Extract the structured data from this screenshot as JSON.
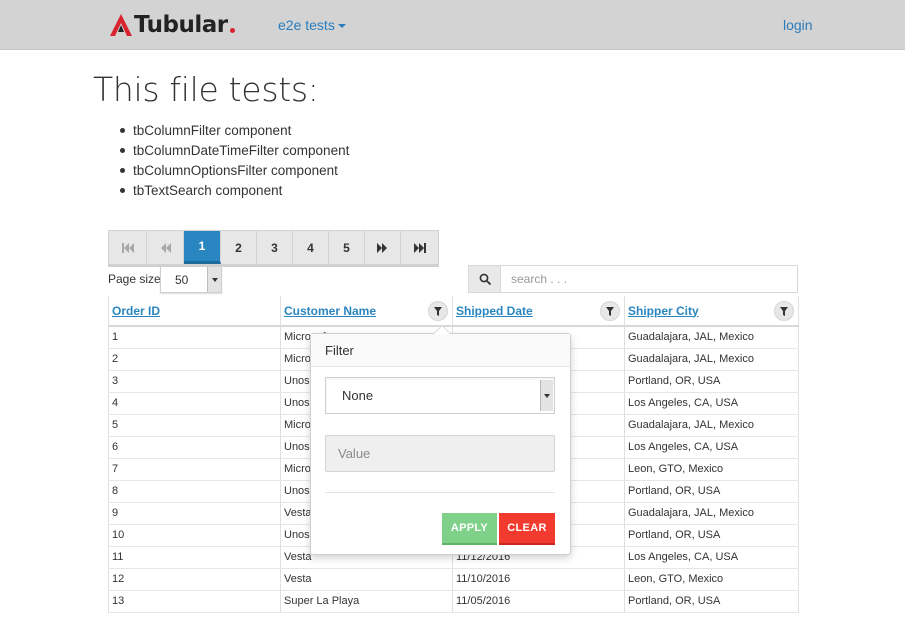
{
  "navbar": {
    "brand": "Tubular",
    "dropdown_label": "e2e tests",
    "login_label": "login"
  },
  "intro": {
    "headline": "This file tests:",
    "items": [
      "tbColumnFilter component",
      "tbColumnDateTimeFilter component",
      "tbColumnOptionsFilter component",
      "tbTextSearch component"
    ]
  },
  "pager": {
    "pages": [
      "1",
      "2",
      "3",
      "4",
      "5"
    ],
    "active_page": "1",
    "icons": [
      "first-page-icon",
      "previous-page-icon",
      "next-page-icon",
      "last-page-icon"
    ]
  },
  "page_size": {
    "label": "Page size:",
    "value": "50"
  },
  "search": {
    "placeholder": "search . . .",
    "icon": "search-icon"
  },
  "table": {
    "columns": [
      "Order ID",
      "Customer Name",
      "Shipped Date",
      "Shipper City"
    ],
    "rows": [
      [
        "1",
        "Microsoft",
        "",
        "Guadalajara, JAL, Mexico"
      ],
      [
        "2",
        "Microsoft",
        "",
        "Guadalajara, JAL, Mexico"
      ],
      [
        "3",
        "Unosquare LLC",
        "",
        "Portland, OR, USA"
      ],
      [
        "4",
        "Unosquare LLC",
        "",
        "Los Angeles, CA, USA"
      ],
      [
        "5",
        "Microsoft",
        "",
        "Guadalajara, JAL, Mexico"
      ],
      [
        "6",
        "Unosquare LLC",
        "",
        "Los Angeles, CA, USA"
      ],
      [
        "7",
        "Microsoft",
        "",
        "Leon, GTO, Mexico"
      ],
      [
        "8",
        "Unosquare LLC",
        "",
        "Portland, OR, USA"
      ],
      [
        "9",
        "Vesta",
        "",
        "Guadalajara, JAL, Mexico"
      ],
      [
        "10",
        "Unosquare LLC",
        "",
        "Portland, OR, USA"
      ],
      [
        "11",
        "Vesta",
        "11/12/2016",
        "Los Angeles, CA, USA"
      ],
      [
        "12",
        "Vesta",
        "11/10/2016",
        "Leon, GTO, Mexico"
      ],
      [
        "13",
        "Super La Playa",
        "11/05/2016",
        "Portland, OR, USA"
      ]
    ]
  },
  "filter_popover": {
    "title": "Filter",
    "operator_value": "None",
    "value_placeholder": "Value",
    "apply_label": "APPLY",
    "clear_label": "CLEAR"
  },
  "colors": {
    "navbar_bg": "#d3d3d3",
    "link": "#2a7dbd",
    "pager_active": "#2a86c0",
    "apply": "#7fd18a",
    "clear": "#f23a2f"
  }
}
